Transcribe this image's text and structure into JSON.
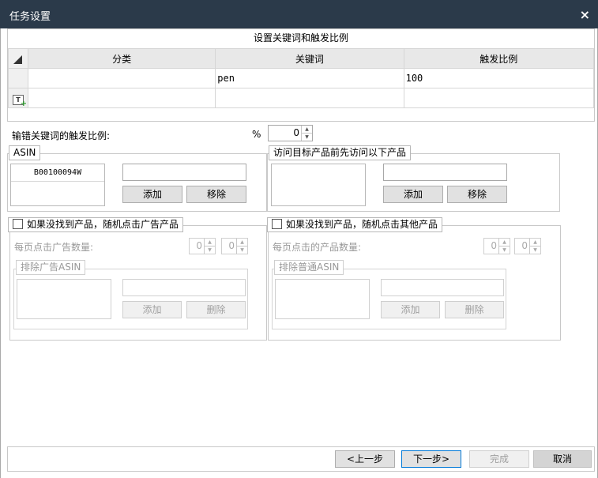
{
  "window": {
    "title": "任务设置",
    "close_glyph": "×"
  },
  "keyword_grid": {
    "caption": "设置关键词和触发比例",
    "columns": [
      "分类",
      "关键词",
      "触发比例"
    ],
    "rows": [
      {
        "category": "",
        "keyword": "pen",
        "ratio": "100"
      }
    ],
    "add_row_glyph": "T"
  },
  "wrong_keyword": {
    "label": "输错关键词的触发比例:",
    "unit": "%",
    "value": "0"
  },
  "asin_group": {
    "legend": "ASIN",
    "items": [
      "B00100094W"
    ],
    "input_value": "",
    "add_label": "添加",
    "remove_label": "移除"
  },
  "visit_group": {
    "legend": "访问目标产品前先访问以下产品",
    "items": [],
    "input_value": "",
    "add_label": "添加",
    "remove_label": "移除"
  },
  "ad_group": {
    "checkbox_label": "如果没找到产品，随机点击广告产品",
    "per_page_label": "每页点击广告数量:",
    "min_value": "0",
    "max_value": "0",
    "exclude_legend": "排除广告ASIN",
    "add_label": "添加",
    "delete_label": "删除"
  },
  "other_group": {
    "checkbox_label": "如果没找到产品，随机点击其他产品",
    "per_page_label": "每页点击的产品数量:",
    "min_value": "0",
    "max_value": "0",
    "exclude_legend": "排除普通ASIN",
    "add_label": "添加",
    "delete_label": "删除"
  },
  "footer": {
    "prev_label": "<上一步",
    "next_label": "下一步>",
    "finish_label": "完成",
    "cancel_label": "取消"
  },
  "colors": {
    "titlebar": "#2b3a4a",
    "accent": "#0078d7"
  }
}
